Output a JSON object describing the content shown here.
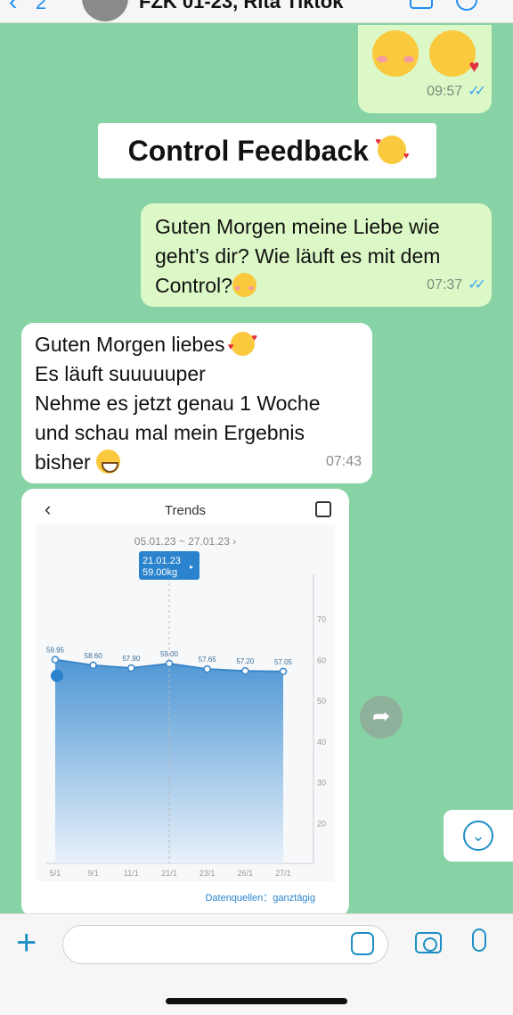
{
  "header": {
    "back_count": "2",
    "contact_title": "FZK 01-23, Rita Tiktok"
  },
  "messages": {
    "m1": {
      "time": "09:57",
      "ticks": "✓✓"
    },
    "label": {
      "text": "Control Feedback"
    },
    "m2": {
      "lines": [
        "Guten Morgen meine Liebe wie",
        "geht’s dir? Wie läuft es mit dem",
        "Control?"
      ],
      "time": "07:37",
      "ticks": "✓✓"
    },
    "m3": {
      "lines": [
        "Guten Morgen liebes",
        "Es läuft suuuuuper",
        "Nehme es jetzt genau 1 Woche",
        "und schau mal mein Ergebnis",
        "bisher"
      ],
      "time": "07:43"
    }
  },
  "image": {
    "header": "Trends",
    "range": "05.01.23 ~ 27.01.23 ›",
    "source": "Datenquellen：ganztägig",
    "tooltip_date": "21.01.23",
    "tooltip_value": "59.00kg"
  },
  "chart_data": {
    "type": "area",
    "categories": [
      "5/1",
      "9/1",
      "11/1",
      "21/1",
      "23/1",
      "26/1",
      "27/1"
    ],
    "values": [
      59.95,
      58.6,
      57.9,
      59.0,
      57.65,
      57.2,
      57.05
    ],
    "value_labels": [
      "59.95",
      "58.60",
      "57.90",
      "59.00",
      "57.65",
      "57.20",
      "57.05"
    ],
    "y_ticks": [
      "70",
      "60",
      "50",
      "40",
      "30",
      "20"
    ],
    "ylim": [
      10,
      80
    ],
    "title": "",
    "xlabel": "",
    "ylabel": "",
    "colors": {
      "fill": "#5aa0d8",
      "line": "#3a86c8"
    }
  },
  "composer": {
    "placeholder": ""
  }
}
